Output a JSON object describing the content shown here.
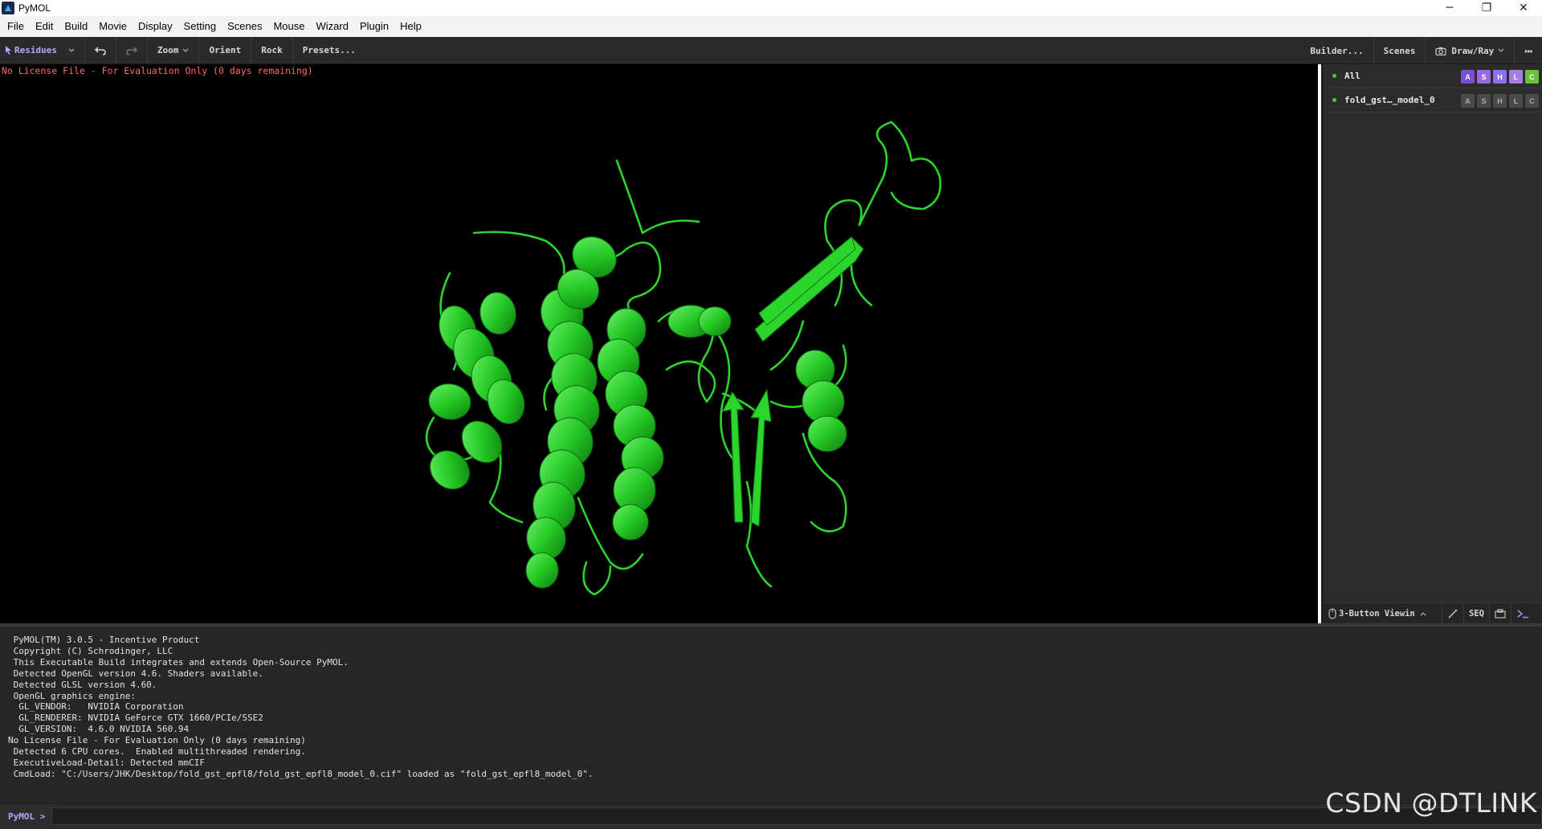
{
  "window": {
    "title": "PyMOL",
    "controls": {
      "minimize": "─",
      "restore": "❐",
      "close": "✕"
    }
  },
  "menubar": {
    "items": [
      "File",
      "Edit",
      "Build",
      "Movie",
      "Display",
      "Setting",
      "Scenes",
      "Mouse",
      "Wizard",
      "Plugin",
      "Help"
    ]
  },
  "toolbar": {
    "selection_mode": "Residues",
    "undo_icon": "undo-icon",
    "redo_icon": "redo-icon",
    "zoom": "Zoom",
    "orient": "Orient",
    "rock": "Rock",
    "presets": "Presets...",
    "builder": "Builder...",
    "scenes": "Scenes",
    "draw_ray": "Draw/Ray",
    "more": "⋯"
  },
  "viewport": {
    "license_message": "No License File - For Evaluation Only (0 days remaining)",
    "representation_color": "#26d426"
  },
  "objects": [
    {
      "name": "All",
      "buttons": [
        "A",
        "S",
        "H",
        "L",
        "C"
      ],
      "colored": true
    },
    {
      "name": "fold_gst…_model_0",
      "buttons": [
        "A",
        "S",
        "H",
        "L",
        "C"
      ],
      "colored": false
    }
  ],
  "button_colors": {
    "A": "#7a4fd1",
    "S": "#9a68e2",
    "H": "#8a72e8",
    "L": "#a87de0",
    "C": "#6cbf3a"
  },
  "panel_bottom": {
    "mouse_mode": "3-Button Viewin",
    "seq": "SEQ"
  },
  "console": {
    "lines": [
      " PyMOL(TM) 3.0.5 - Incentive Product",
      " Copyright (C) Schrodinger, LLC",
      "",
      " This Executable Build integrates and extends Open-Source PyMOL.",
      " Detected OpenGL version 4.6. Shaders available.",
      " Detected GLSL version 4.60.",
      " OpenGL graphics engine:",
      "  GL_VENDOR:   NVIDIA Corporation",
      "  GL_RENDERER: NVIDIA GeForce GTX 1660/PCIe/SSE2",
      "  GL_VERSION:  4.6.0 NVIDIA 560.94",
      "No License File - For Evaluation Only (0 days remaining)",
      " Detected 6 CPU cores.  Enabled multithreaded rendering.",
      " ExecutiveLoad-Detail: Detected mmCIF",
      " CmdLoad: \"C:/Users/JHK/Desktop/fold_gst_epfl8/fold_gst_epfl8_model_0.cif\" loaded as \"fold_gst_epfl8_model_0\"."
    ]
  },
  "cmdline": {
    "prompt": "PyMOL >",
    "value": ""
  },
  "watermark": "CSDN @DTLINK"
}
